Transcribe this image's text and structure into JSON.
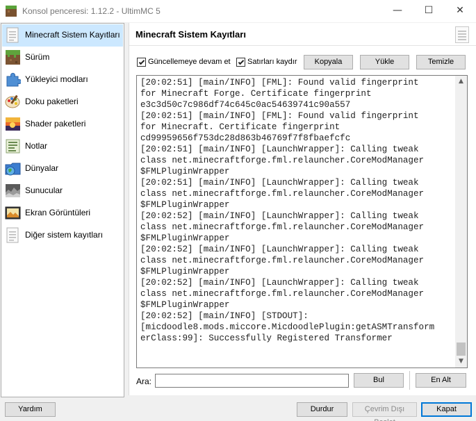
{
  "window": {
    "title": "Konsol penceresi: 1.12.2 - UltimMC 5",
    "controls": {
      "minimize": "—",
      "maximize": "☐",
      "close": "✕"
    }
  },
  "sidebar": {
    "selected_index": 0,
    "items": [
      {
        "label": "Minecraft Sistem Kayıtları",
        "icon": "log-icon"
      },
      {
        "label": "Sürüm",
        "icon": "grass-block-icon"
      },
      {
        "label": "Yükleyici modları",
        "icon": "puzzle-icon"
      },
      {
        "label": "Doku paketleri",
        "icon": "paint-palette-icon"
      },
      {
        "label": "Shader paketleri",
        "icon": "sunset-icon"
      },
      {
        "label": "Notlar",
        "icon": "notes-icon"
      },
      {
        "label": "Dünyalar",
        "icon": "world-icon"
      },
      {
        "label": "Sunucular",
        "icon": "server-icon"
      },
      {
        "label": "Ekran Görüntüleri",
        "icon": "screenshot-icon"
      },
      {
        "label": "Diğer sistem kayıtları",
        "icon": "document-icon"
      }
    ]
  },
  "page": {
    "title": "Minecraft Sistem Kayıtları",
    "icon": "document-icon"
  },
  "toolbar": {
    "keep_updating": {
      "label": "Güncellemeye devam et",
      "checked": true
    },
    "wrap_lines": {
      "label": "Satırları kaydır",
      "checked": true
    },
    "copy_label": "Kopyala",
    "upload_label": "Yükle",
    "clear_label": "Temizle"
  },
  "log": {
    "lines": [
      "[20:02:51] [main/INFO] [FML]: Found valid fingerprint",
      "for Minecraft Forge. Certificate fingerprint",
      "e3c3d50c7c986df74c645c0ac54639741c90a557",
      "[20:02:51] [main/INFO] [FML]: Found valid fingerprint",
      "for Minecraft. Certificate fingerprint",
      "cd99959656f753dc28d863b46769f7f8fbaefcfc",
      "[20:02:51] [main/INFO] [LaunchWrapper]: Calling tweak",
      "class net.minecraftforge.fml.relauncher.CoreModManager",
      "$FMLPluginWrapper",
      "[20:02:51] [main/INFO] [LaunchWrapper]: Calling tweak",
      "class net.minecraftforge.fml.relauncher.CoreModManager",
      "$FMLPluginWrapper",
      "[20:02:52] [main/INFO] [LaunchWrapper]: Calling tweak",
      "class net.minecraftforge.fml.relauncher.CoreModManager",
      "$FMLPluginWrapper",
      "[20:02:52] [main/INFO] [LaunchWrapper]: Calling tweak",
      "class net.minecraftforge.fml.relauncher.CoreModManager",
      "$FMLPluginWrapper",
      "[20:02:52] [main/INFO] [LaunchWrapper]: Calling tweak",
      "class net.minecraftforge.fml.relauncher.CoreModManager",
      "$FMLPluginWrapper",
      "[20:02:52] [main/INFO] [STDOUT]:",
      "[micdoodle8.mods.miccore.MicdoodlePlugin:getASMTransform",
      "erClass:99]: Successfully Registered Transformer"
    ]
  },
  "search": {
    "label": "Ara:",
    "value": "",
    "find_label": "Bul",
    "bottom_label": "En Alt"
  },
  "footer": {
    "help_label": "Yardım",
    "stop_label": "Durdur",
    "offline_label": "Çevrim Dışı Başlat",
    "close_label": "Kapat"
  }
}
